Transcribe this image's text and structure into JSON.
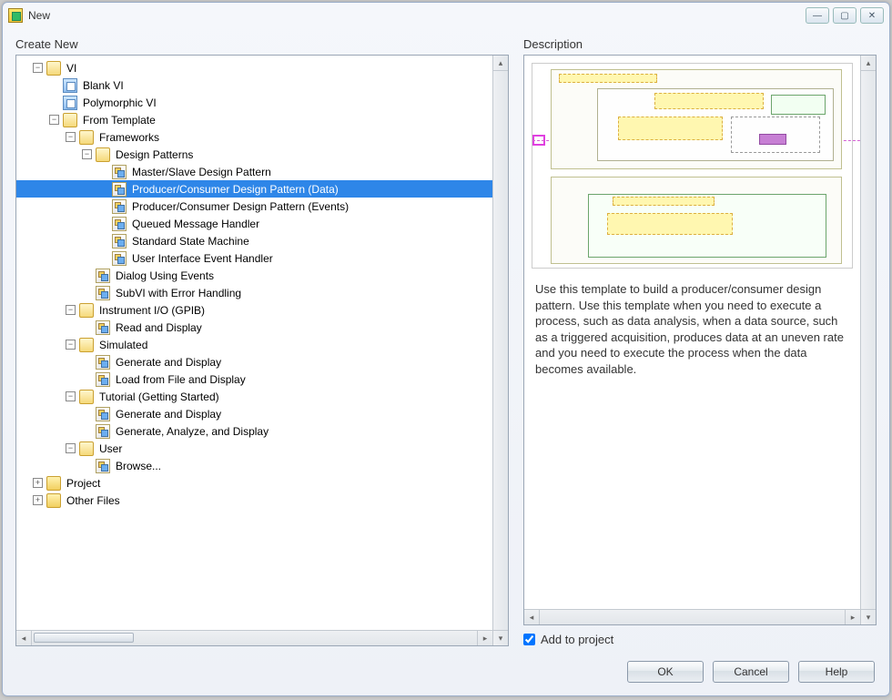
{
  "window": {
    "title": "New"
  },
  "labels": {
    "create_new": "Create New",
    "description": "Description"
  },
  "tree": {
    "vi": "VI",
    "blank_vi": "Blank VI",
    "polymorphic_vi": "Polymorphic VI",
    "from_template": "From Template",
    "frameworks": "Frameworks",
    "design_patterns": "Design Patterns",
    "master_slave": "Master/Slave Design Pattern",
    "prod_cons_data": "Producer/Consumer Design Pattern (Data)",
    "prod_cons_events": "Producer/Consumer Design Pattern (Events)",
    "queued_msg": "Queued Message Handler",
    "state_machine": "Standard State Machine",
    "ui_event_handler": "User Interface Event Handler",
    "dialog_events": "Dialog Using Events",
    "subvi_error": "SubVI with Error Handling",
    "instrument_io": "Instrument I/O (GPIB)",
    "read_display": "Read and Display",
    "simulated": "Simulated",
    "gen_display": "Generate and Display",
    "load_file": "Load from File and Display",
    "tutorial": "Tutorial (Getting Started)",
    "gen_display2": "Generate and Display",
    "gen_analyze": "Generate, Analyze, and Display",
    "user": "User",
    "browse": "Browse...",
    "project": "Project",
    "other_files": "Other Files"
  },
  "description_text": "Use this template to build a producer/consumer design pattern. Use this template when you need to execute a process, such as data analysis, when a data source, such as a triggered acquisition, produces data at an uneven rate and you need to execute the process when the data becomes available.",
  "checkbox": {
    "add_to_project": "Add to project",
    "checked": true
  },
  "buttons": {
    "ok": "OK",
    "cancel": "Cancel",
    "help": "Help"
  }
}
